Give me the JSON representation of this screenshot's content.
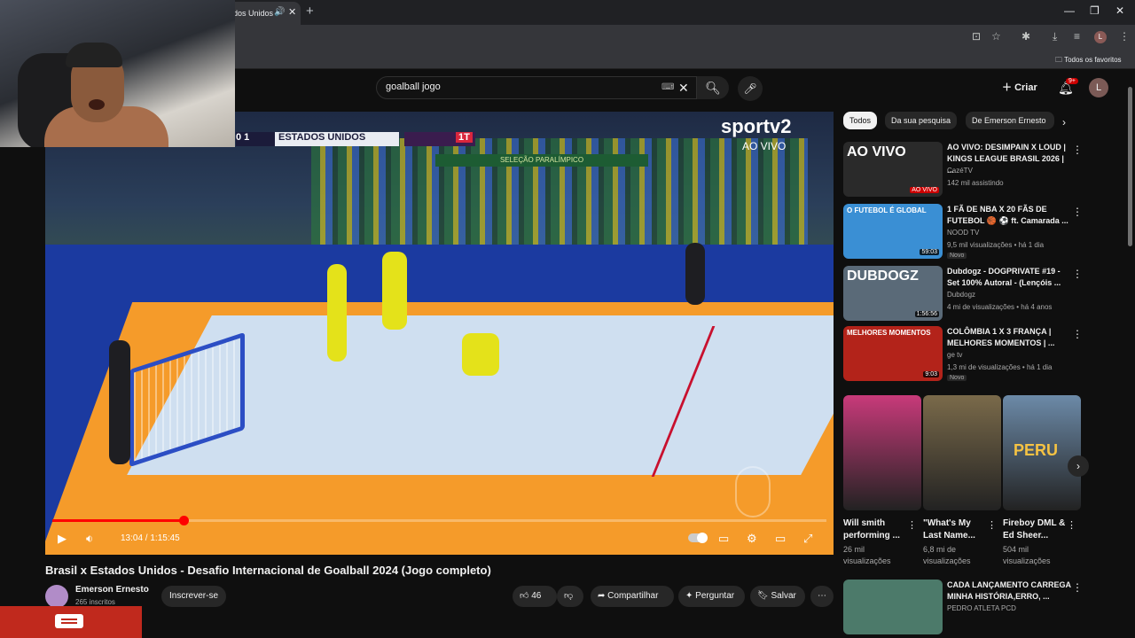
{
  "browser": {
    "tab_title": "dos Unidos",
    "bookmarks_label": "Todos os favoritos",
    "profile_letter": "L"
  },
  "youtube": {
    "search": {
      "value": "goalball jogo"
    },
    "create_label": "Criar",
    "notifications_badge": "9+",
    "avatar_letter": "L"
  },
  "player": {
    "scorebug": {
      "score": "0  1",
      "team": "ESTADOS UNIDOS",
      "period": "1T"
    },
    "broadcaster": "sportv2",
    "live_label": "AO VIVO",
    "arena_banner": "SELEÇÃO PARALÍMPICO",
    "time": "13:04 / 1:15:45",
    "progress": 0.17
  },
  "video": {
    "title": "Brasil x Estados Unidos - Desafio Internacional de Goalball 2024 (Jogo completo)",
    "channel": "Emerson Ernesto",
    "subscribers": "265 inscritos",
    "subscribe_label": "Inscrever-se",
    "likes": "46",
    "share_label": "Compartilhar",
    "ask_label": "Perguntar",
    "save_label": "Salvar"
  },
  "sidebar": {
    "chips": [
      "Todos",
      "Da sua pesquisa",
      "De Emerson Ernesto"
    ],
    "recommendations": [
      {
        "title": "AO VIVO: DESIMPAIN X LOUD | KINGS LEAGUE BRASIL 2026 | ...",
        "channel": "CazéTV",
        "meta": "142 mil assistindo",
        "badge": "",
        "duration": "AO VIVO",
        "thumb_text": "AO VIVO",
        "thumb_color": "#2a2a2a"
      },
      {
        "title": "1 FÃ DE NBA X 20 FÃS DE FUTEBOL 🏀 ⚽ ft. Camarada ...",
        "channel": "NOOD TV",
        "meta": "9,5 mil visualizações • há 1 dia",
        "badge": "Novo",
        "duration": "59:03",
        "thumb_text": "O FUTEBOL É GLOBAL",
        "thumb_color": "#3a8fd4"
      },
      {
        "title": "Dubdogz - DOGPRIVATE #19 - Set 100% Autoral - (Lençóis ...",
        "channel": "Dubdogz",
        "meta": "4 mi de visualizações • há 4 anos",
        "badge": "",
        "duration": "1:56:56",
        "thumb_text": "DUBDOGZ",
        "thumb_color": "#5a6a78"
      },
      {
        "title": "COLÔMBIA 1 X 3 FRANÇA | MELHORES MOMENTOS | ...",
        "channel": "ge tv",
        "meta": "1,3 mi de visualizações • há 1 dia",
        "badge": "Novo",
        "duration": "9:03",
        "thumb_text": "MELHORES MOMENTOS",
        "thumb_color": "#b3231a"
      },
      {
        "title": "CADA LANÇAMENTO CARREGA MINHA HISTÓRIA,ERRO, ...",
        "channel": "PEDRO ATLETA PCD",
        "meta": "",
        "badge": "",
        "duration": "",
        "thumb_text": "",
        "thumb_color": "#4c7a6a"
      }
    ],
    "shorts": [
      {
        "title": "Will smith performing ...",
        "views": "26 mil visualizações",
        "thumb_color": "#c83a7a",
        "thumb_text": ""
      },
      {
        "title": "\"What's My Last Name...",
        "views": "6,8 mi de visualizações",
        "thumb_color": "#7a6a4a",
        "thumb_text": ""
      },
      {
        "title": "Fireboy DML & Ed Sheer...",
        "views": "504 mil visualizações",
        "thumb_color": "#6c8aa8",
        "thumb_text": "PERU"
      }
    ]
  }
}
